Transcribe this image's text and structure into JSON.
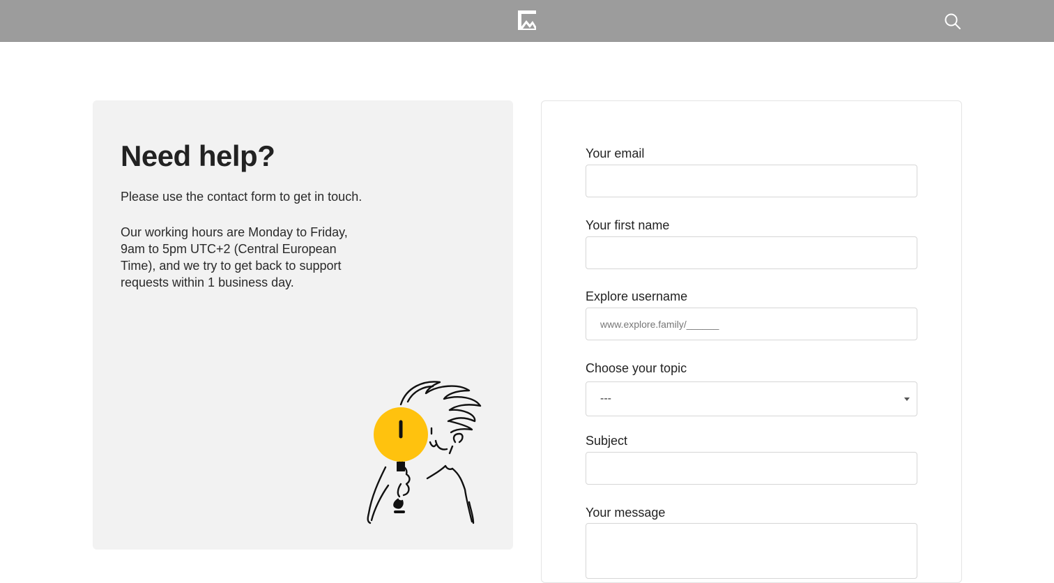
{
  "colors": {
    "header_bg": "#9c9c9c",
    "panel_bg": "#f2f2f2",
    "accent_yellow": "#ffc20e",
    "text": "#222222",
    "border": "#d6d6d6"
  },
  "header": {
    "logo_icon": "explore-logo-icon",
    "search_icon": "search-icon"
  },
  "help": {
    "title": "Need help?",
    "intro": "Please use the contact form to get in touch.",
    "hours": "Our working hours are Monday to Friday, 9am to 5pm UTC+2 (Central European Time), and we try to get back to support requests within 1 business day."
  },
  "form": {
    "email": {
      "label": "Your email",
      "value": "",
      "placeholder": ""
    },
    "first_name": {
      "label": "Your first name",
      "value": "",
      "placeholder": ""
    },
    "username": {
      "label": "Explore username",
      "value": "",
      "placeholder": "www.explore.family/______"
    },
    "topic": {
      "label": "Choose your topic",
      "selected": "---"
    },
    "subject": {
      "label": "Subject",
      "value": "",
      "placeholder": ""
    },
    "message": {
      "label": "Your message",
      "value": "",
      "placeholder": ""
    }
  }
}
